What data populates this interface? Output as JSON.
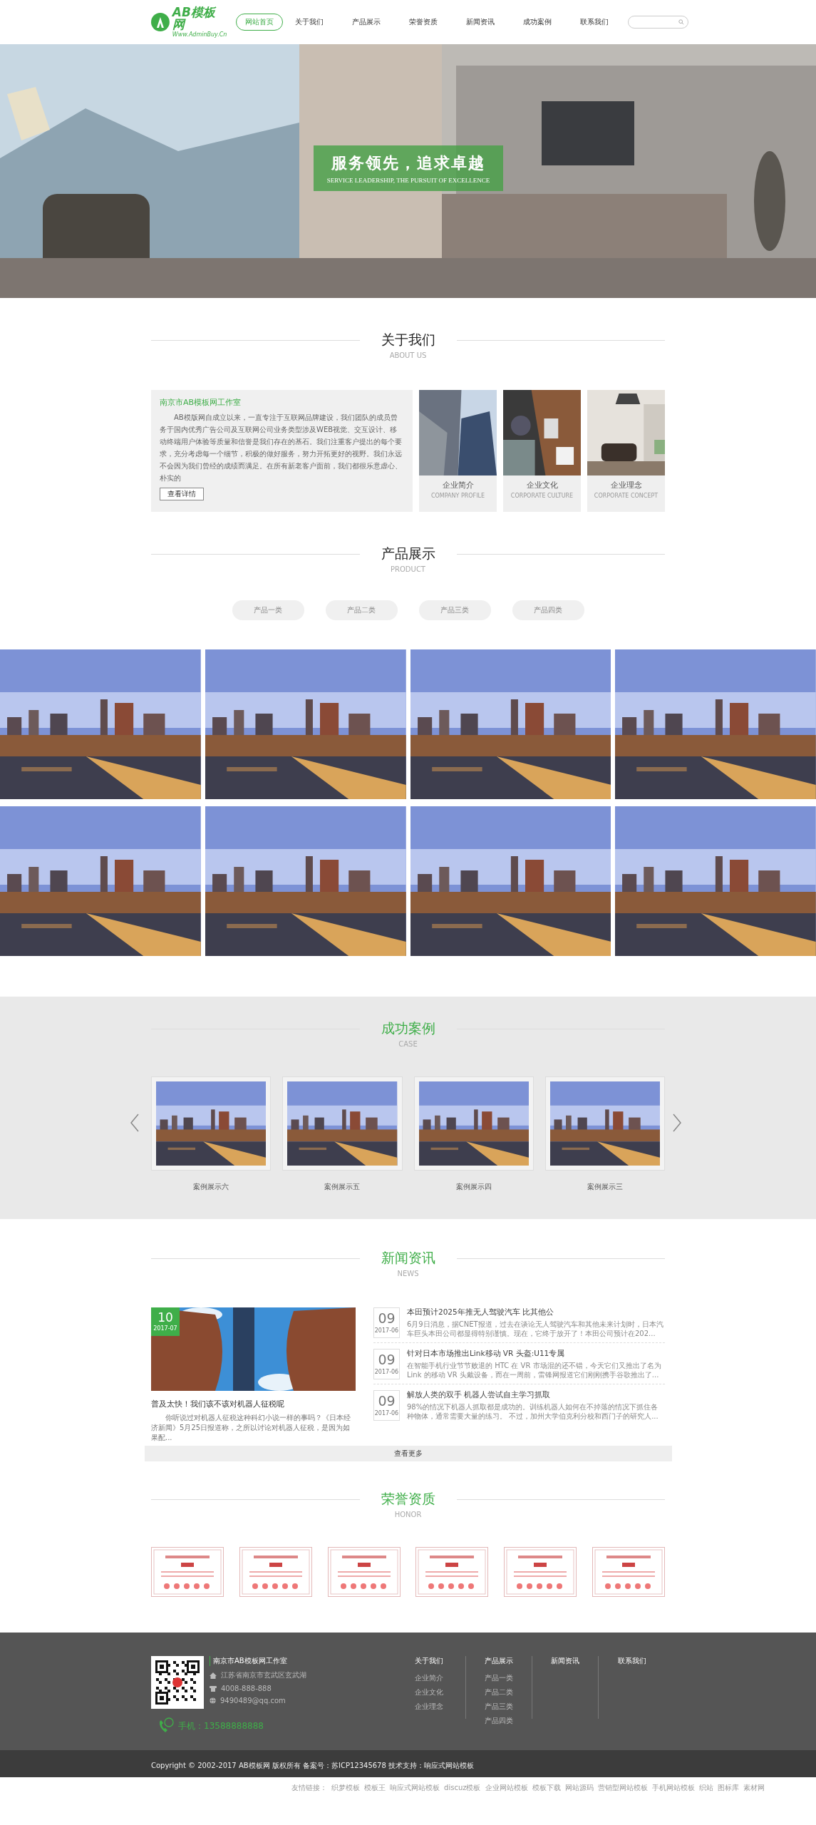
{
  "header": {
    "logo": {
      "name": "AB模板网",
      "url": "Www.AdminBuy.Cn"
    },
    "nav": [
      {
        "label": "网站首页",
        "selected": true
      },
      {
        "label": "关于我们",
        "selected": false
      },
      {
        "label": "产品展示",
        "selected": false
      },
      {
        "label": "荣誉资质",
        "selected": false
      },
      {
        "label": "新闻资讯",
        "selected": false
      },
      {
        "label": "成功案例",
        "selected": false
      },
      {
        "label": "联系我们",
        "selected": false
      }
    ]
  },
  "banner": {
    "title": "服务领先，追求卓越",
    "subtitle": "SERVICE LEADERSHIP, THE PURSUIT OF EXCELLENCE"
  },
  "about": {
    "title": "关于我们",
    "subtitle": "ABOUT US",
    "company": "南京市AB模板网工作室",
    "text": "AB模版网自成立以来，一直专注于互联网品牌建设，我们团队的成员曾务于国内优秀广告公司及互联网公司业务类型涉及WEB视觉、交互设计、移动终端用户体验等质量和信誉是我们存在的基石。我们注重客户提出的每个要求，充分考虑每一个细节，积极的做好服务，努力开拓更好的视野。我们永远不会因为我们曾经的成绩而满足。在所有新老客户面前，我们都很乐意虚心、朴实的",
    "button": "查看详情",
    "cards": [
      {
        "title": "企业简介",
        "subtitle": "COMPANY PROFILE"
      },
      {
        "title": "企业文化",
        "subtitle": "CORPORATE CULTURE"
      },
      {
        "title": "企业理念",
        "subtitle": "CORPORATE CONCEPT"
      }
    ]
  },
  "products": {
    "title": "产品展示",
    "subtitle": "PRODUCT",
    "tabs": [
      "产品一类",
      "产品二类",
      "产品三类",
      "产品四类"
    ]
  },
  "cases": {
    "title": "成功案例",
    "subtitle": "CASE",
    "items": [
      "案例展示六",
      "案例展示五",
      "案例展示四",
      "案例展示三"
    ]
  },
  "news": {
    "title": "新闻资讯",
    "subtitle": "NEWS",
    "featured": {
      "day": "10",
      "month": "2017-07",
      "title": "普及太快！我们该不该对机器人征税呢",
      "text": "你听说过对机器人征税这种科幻小说一样的事吗？《日本经济新闻》5月25日报道称，之所以讨论对机器人征税，是因为如果配..."
    },
    "items": [
      {
        "day": "09",
        "month": "2017-06",
        "title": "本田预计2025年推无人驾驶汽车 比其他公",
        "text": "6月9日消息，据CNET报道，过去在谈论无人驾驶汽车和其他未来计划时，日本汽车巨头本田公司都显得特别谨慎。现在，它终于放开了！本田公司预计在202..."
      },
      {
        "day": "09",
        "month": "2017-06",
        "title": "针对日本市场推出Link移动 VR 头盔:U11专属",
        "text": "在智能手机行业节节败退的 HTC 在 VR 市场混的还不错，今天它们又推出了名为 Link 的移动 VR 头戴设备，而在一周前，雷锋网报道它们刚刚携手谷歌推出了..."
      },
      {
        "day": "09",
        "month": "2017-06",
        "title": "解放人类的双手 机器人尝试自主学习抓取",
        "text": "98%的情况下机器人抓取都是成功的。训练机器人如何在不掉落的情况下抓住各种物体，通常需要大量的练习。 不过，加州大学伯克利分校和西门子的研究人..."
      }
    ],
    "more": "查看更多"
  },
  "honor": {
    "title": "荣誉资质",
    "subtitle": "HONOR"
  },
  "footer": {
    "company": "南京市AB模板网工作室",
    "address": "江苏省南京市玄武区玄武湖",
    "phone": "4008-888-888",
    "email": "9490489@qq.com",
    "mobile": "手机：13588888888",
    "columns": [
      {
        "title": "关于我们",
        "links": [
          "企业简介",
          "企业文化",
          "企业理念"
        ]
      },
      {
        "title": "产品展示",
        "links": [
          "产品一类",
          "产品二类",
          "产品三类",
          "产品四类"
        ]
      },
      {
        "title": "新闻资讯"
      },
      {
        "title": "联系我们"
      }
    ],
    "copyright": "Copyright © 2002-2017 AB模板网 版权所有 备案号：苏ICP12345678 技术支持：响应式网站模板",
    "friend_links": [
      "友情链接：",
      "织梦模板",
      "模板王",
      "响应式网站模板",
      "discuz模板",
      "企业网站模板",
      "模板下载",
      "网站源码",
      "营销型网站模板",
      "手机网站模板",
      "织站",
      "图标库",
      "素材网"
    ]
  }
}
